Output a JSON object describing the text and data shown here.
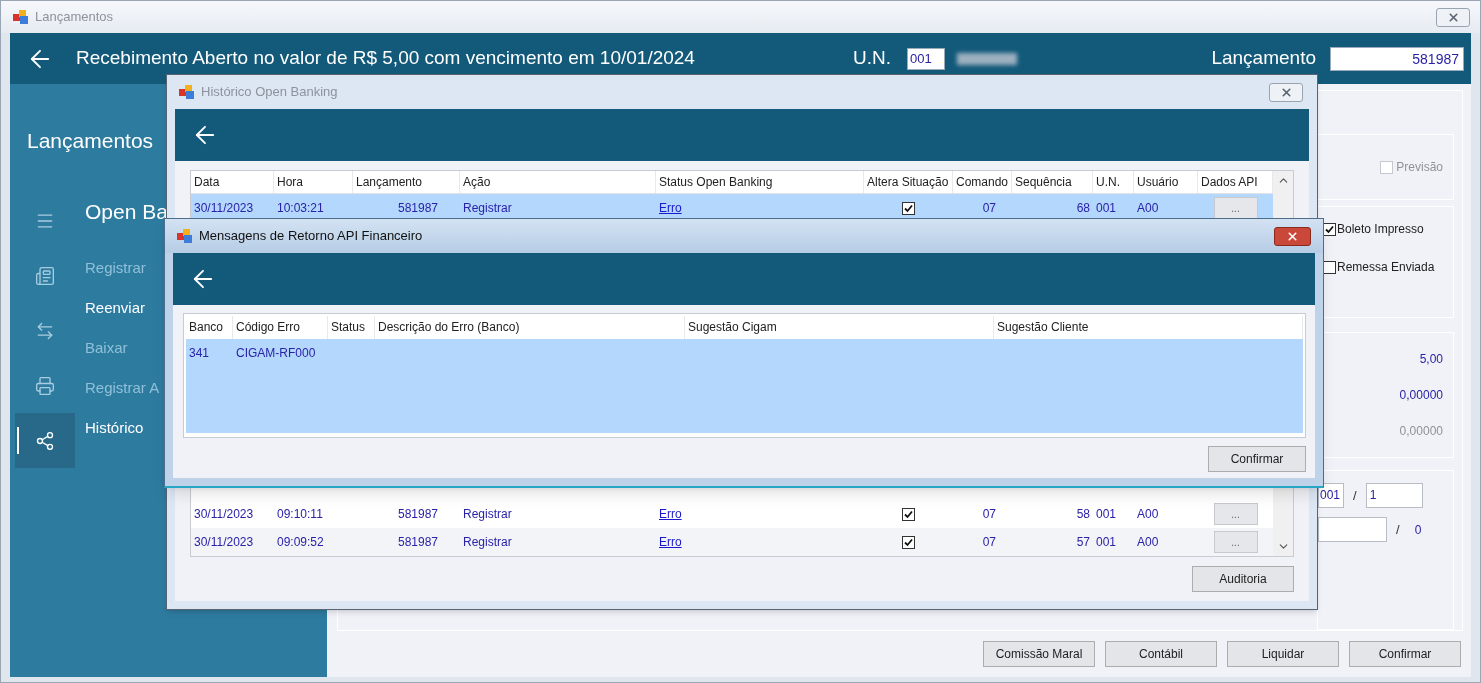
{
  "window": {
    "title": "Lançamentos"
  },
  "header": {
    "title": "Recebimento Aberto no valor de R$ 5,00 com vencimento em 10/01/2024",
    "un_label": "U.N.",
    "un_value": "001",
    "lancamento_label": "Lançamento",
    "lancamento_value": "581987"
  },
  "sidebar": {
    "title": "Lançamentos",
    "icons": [
      {
        "kind": "menu",
        "selected": false
      },
      {
        "kind": "document",
        "selected": false
      },
      {
        "kind": "swap",
        "selected": false
      },
      {
        "kind": "printer",
        "selected": false
      },
      {
        "kind": "nodes",
        "selected": true
      }
    ],
    "items": [
      {
        "label": "Open Ba",
        "kind": "heading",
        "disabled": false
      },
      {
        "label": "Registrar",
        "kind": "item",
        "disabled": true
      },
      {
        "label": "Reenviar",
        "kind": "item",
        "disabled": false
      },
      {
        "label": "Baixar",
        "kind": "item",
        "disabled": true
      },
      {
        "label": "Registrar A",
        "kind": "item",
        "disabled": true
      },
      {
        "label": "Histórico",
        "kind": "item",
        "disabled": false
      }
    ]
  },
  "options": [
    {
      "label": "Previsão",
      "checked": false,
      "disabled": true
    },
    {
      "label": "Boleto Impresso",
      "checked": true,
      "disabled": false
    },
    {
      "label": "Remessa Enviada",
      "checked": false,
      "disabled": false
    }
  ],
  "values": [
    {
      "text": "5,00",
      "disabled": false
    },
    {
      "text": "0,00000",
      "disabled": false
    },
    {
      "text": "0,00000",
      "disabled": true
    }
  ],
  "parcel": {
    "first": "001",
    "separator_1": "/",
    "second": "1",
    "separator_2": "/",
    "count": "0"
  },
  "buttons": [
    "Comissão Maral",
    "Contábil",
    "Liquidar",
    "Confirmar"
  ],
  "history_dialog": {
    "title": "Histórico Open Banking",
    "columns": [
      "Data",
      "Hora",
      "Lançamento",
      "Ação",
      "Status Open Banking",
      "Altera Situação",
      "Comando",
      "Sequência",
      "U.N.",
      "Usuário",
      "Dados API"
    ],
    "rows": [
      {
        "cells": [
          "30/11/2023",
          "10:03:21",
          "581987",
          "Registrar"
        ],
        "status": "Erro",
        "altera_situacao": true,
        "tail": [
          "07",
          "68",
          "001",
          "A00"
        ],
        "api_button": "...",
        "selected": true
      },
      {
        "cells": [
          "30/11/2023",
          "09:10:11",
          "581987",
          "Registrar"
        ],
        "status": "Erro",
        "altera_situacao": true,
        "tail": [
          "07",
          "58",
          "001",
          "A00"
        ],
        "api_button": "...",
        "selected": false
      },
      {
        "cells": [
          "30/11/2023",
          "09:09:52",
          "581987",
          "Registrar"
        ],
        "status": "Erro",
        "altera_situacao": true,
        "tail": [
          "07",
          "57",
          "001",
          "A00"
        ],
        "api_button": "...",
        "selected": false
      }
    ],
    "button": "Auditoria"
  },
  "messages_dialog": {
    "title": "Mensagens de Retorno API Financeiro",
    "columns": [
      "Banco",
      "Código Erro",
      "Status",
      "Descrição do Erro (Banco)",
      "Sugestão Cigam",
      "Sugestão Cliente"
    ],
    "rows": [
      {
        "cells": [
          "341",
          "CIGAM-RF000"
        ],
        "selected": true
      }
    ],
    "button": "Confirmar"
  }
}
